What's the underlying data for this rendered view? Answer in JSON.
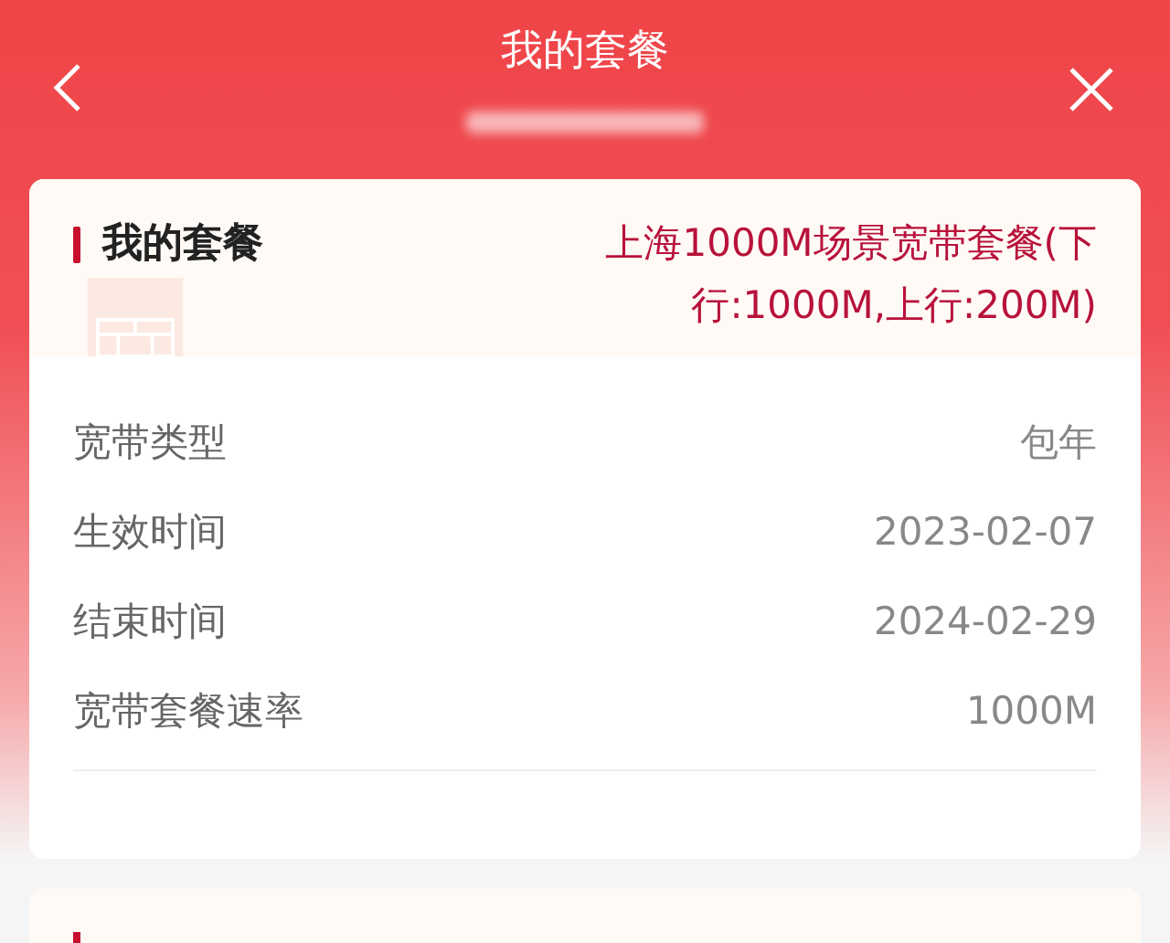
{
  "header": {
    "title": "我的套餐"
  },
  "plan_card": {
    "title": "我的套餐",
    "plan_name": "上海1000M场景宽带套餐(下行:1000M,上行:200M)",
    "rows": [
      {
        "label": "宽带类型",
        "value": "包年"
      },
      {
        "label": "生效时间",
        "value": "2023-02-07"
      },
      {
        "label": "结束时间",
        "value": "2024-02-29"
      },
      {
        "label": "宽带套餐速率",
        "value": "1000M"
      }
    ]
  }
}
